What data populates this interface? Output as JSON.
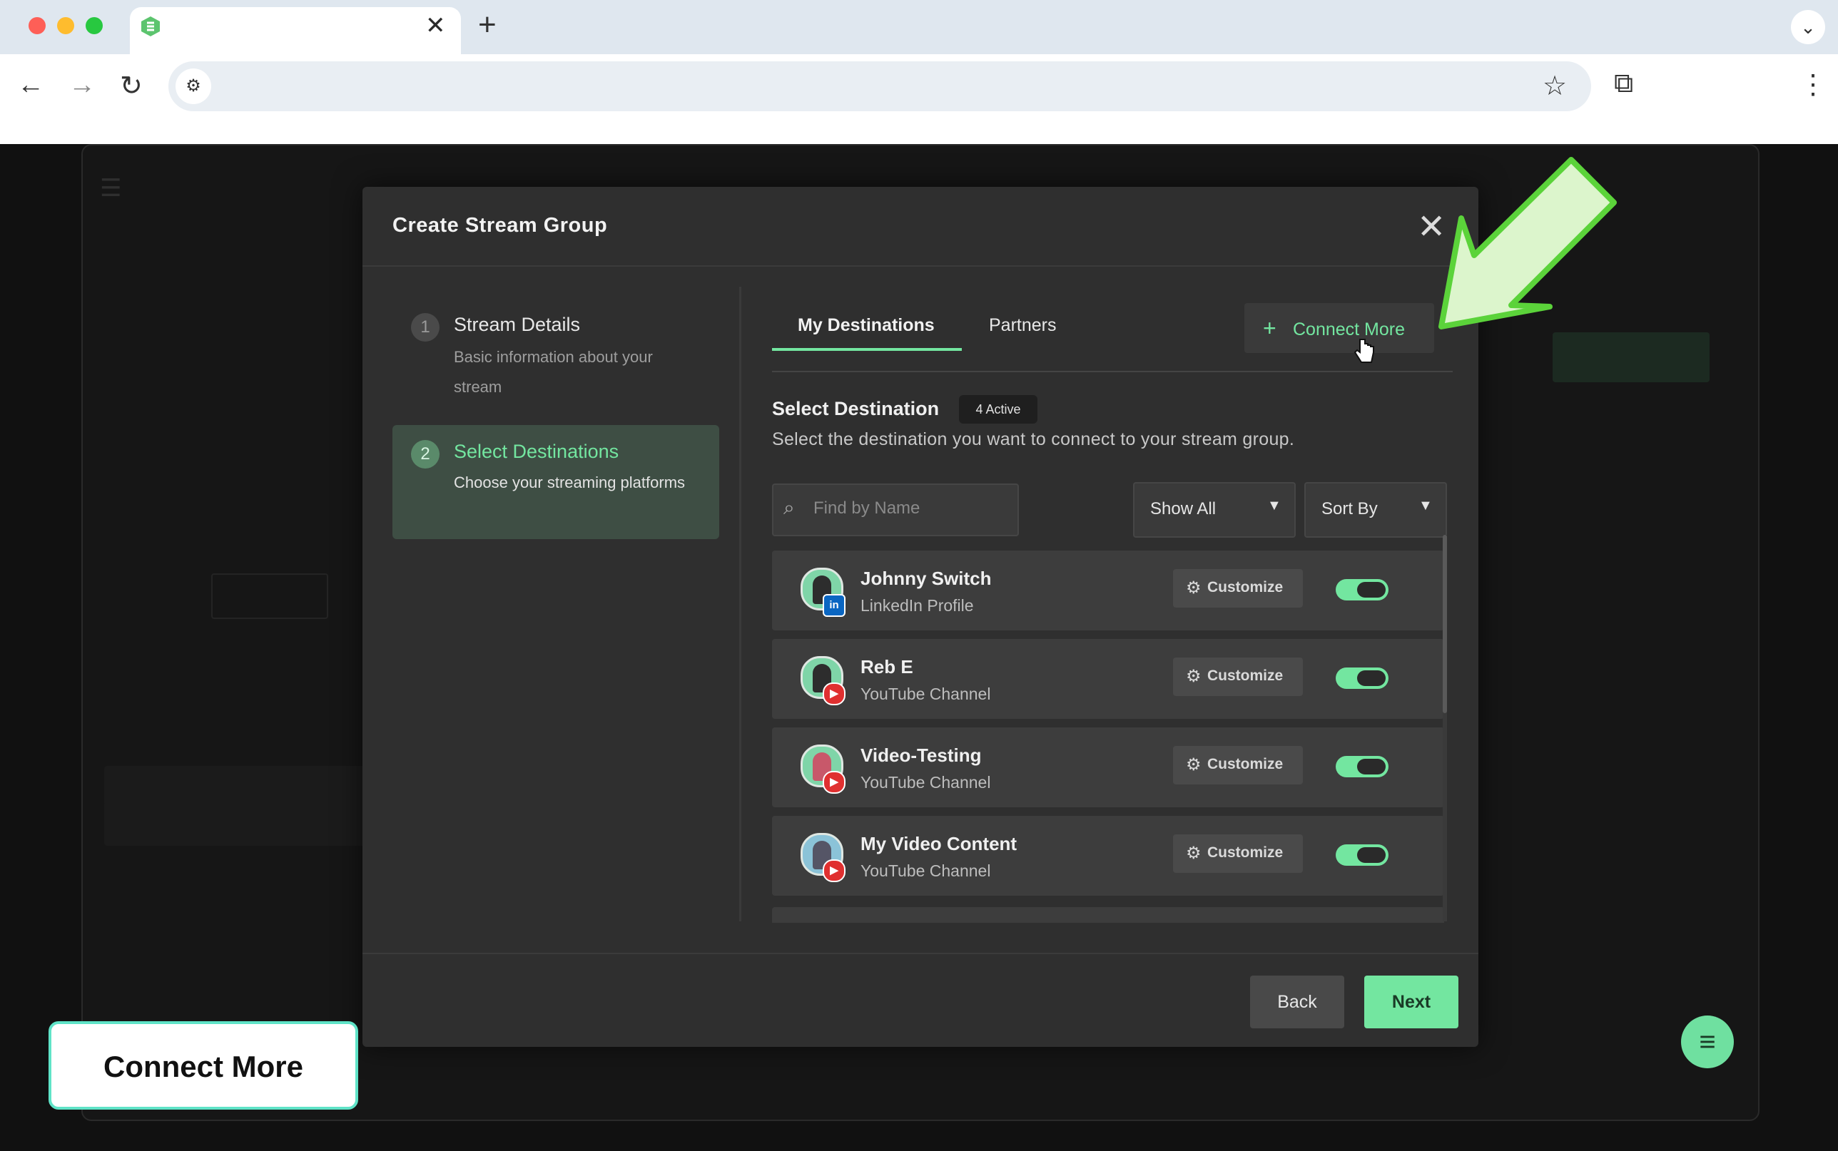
{
  "browser": {
    "address": "",
    "tab_title": "",
    "tab_close": "✕",
    "new_tab": "+"
  },
  "modal": {
    "title": "Create Stream Group",
    "close_glyph": "✕"
  },
  "steps": [
    {
      "number": "1",
      "title": "Stream Details",
      "description": "Basic information about your stream"
    },
    {
      "number": "2",
      "title": "Select Destinations",
      "description": "Choose your streaming platforms"
    }
  ],
  "tabs": {
    "my_destinations": "My Destinations",
    "partners": "Partners",
    "connect_more": "Connect More",
    "connect_more_plus": "+"
  },
  "select": {
    "title": "Select Destination",
    "badge": "4 Active",
    "subtitle": "Select the destination you want to connect to your stream group."
  },
  "filters": {
    "search_placeholder": "Find by Name",
    "show": "Show All",
    "sort": "Sort By"
  },
  "destinations": [
    {
      "name": "Johnny Switch",
      "type": "LinkedIn Profile",
      "platform": "in",
      "enabled": true,
      "customize": "Customize"
    },
    {
      "name": "Reb E",
      "type": "YouTube Channel",
      "platform": "▶",
      "enabled": true,
      "customize": "Customize"
    },
    {
      "name": "Video-Testing",
      "type": "YouTube Channel",
      "platform": "▶",
      "enabled": true,
      "customize": "Customize"
    },
    {
      "name": "My Video Content",
      "type": "YouTube Channel",
      "platform": "▶",
      "enabled": true,
      "customize": "Customize"
    }
  ],
  "footer": {
    "back": "Back",
    "next": "Next"
  },
  "callout": {
    "text": "Connect More"
  },
  "colors": {
    "accent": "#73e6a0",
    "arrow": "#5bd33a",
    "callout_border": "#5fe3c7"
  }
}
